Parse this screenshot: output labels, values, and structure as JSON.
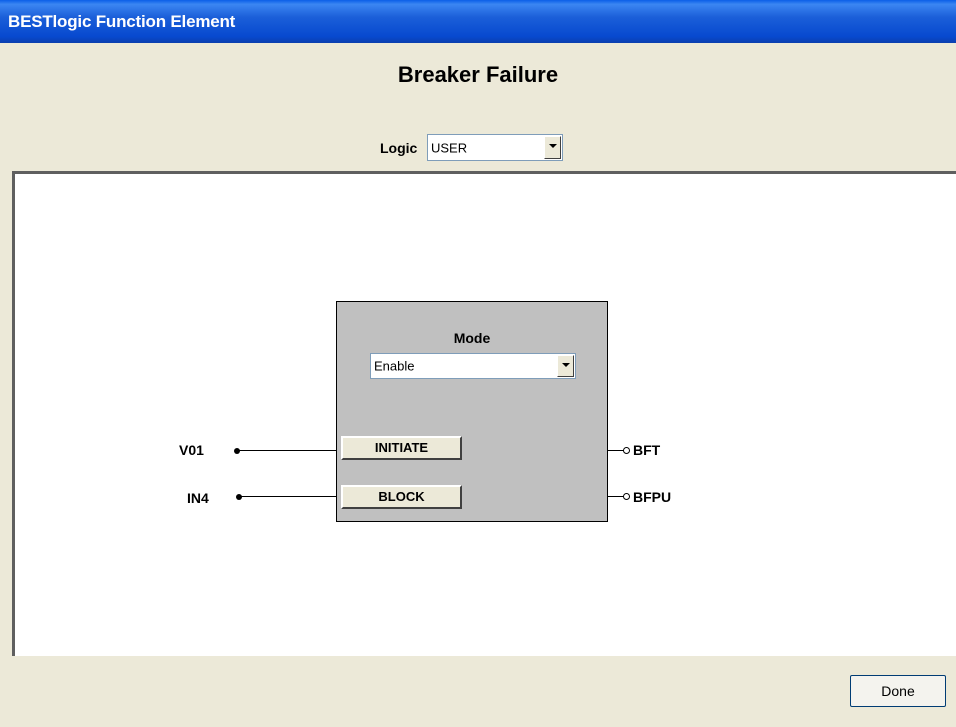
{
  "window": {
    "title": "BESTlogic Function Element"
  },
  "header": {
    "title": "Breaker Failure",
    "logic_label": "Logic",
    "logic_value": "USER"
  },
  "block": {
    "mode_label": "Mode",
    "mode_value": "Enable",
    "inputs": [
      {
        "signal": "V01",
        "button": "INITIATE"
      },
      {
        "signal": "IN4",
        "button": "BLOCK"
      }
    ],
    "outputs": [
      {
        "signal": "BFT"
      },
      {
        "signal": "BFPU"
      }
    ]
  },
  "footer": {
    "done_label": "Done"
  }
}
